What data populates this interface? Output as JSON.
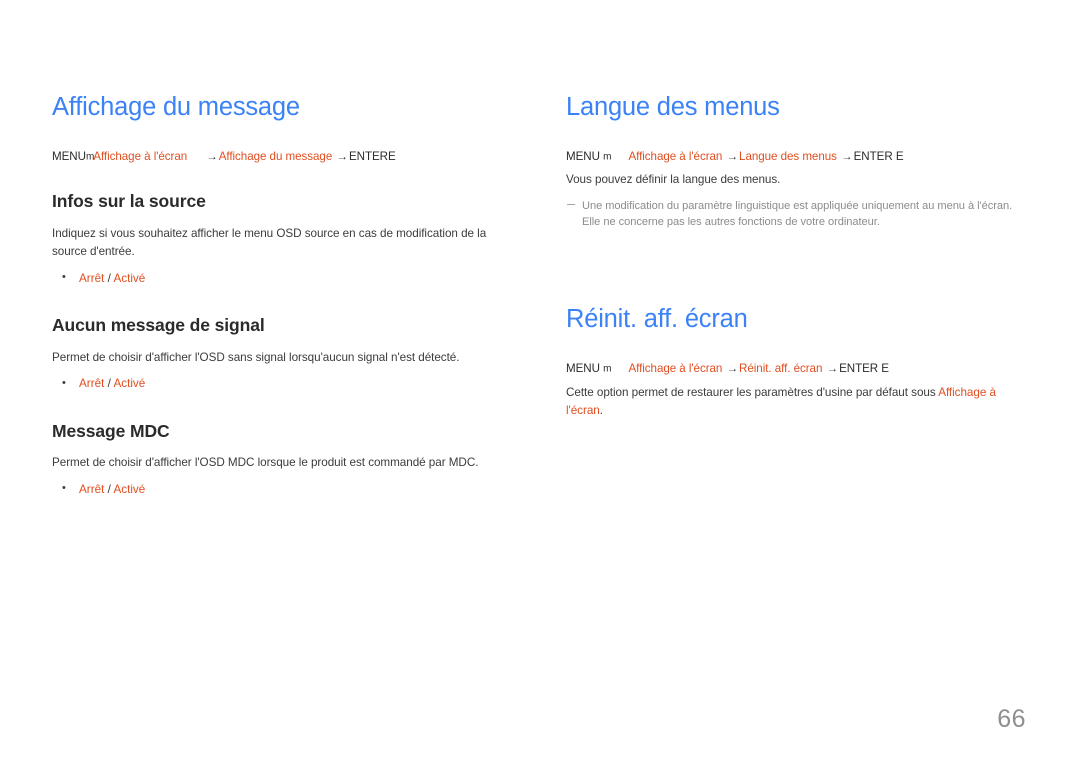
{
  "document": {
    "page_number": "66",
    "accent_heading_color": "#3b82f6",
    "accent_link_color": "#e04e20",
    "body_text_color": "#3c3c3c",
    "note_text_color": "#8c8c8c",
    "background_color": "#ffffff"
  },
  "left_column": {
    "title": "Affichage du message",
    "path": {
      "menu_label": "MENU",
      "menu_glyph": "m",
      "crumb_1": "Affichage à l'écran",
      "arrow_1": "→",
      "crumb_2": "Affichage du message",
      "arrow_2": "→",
      "enter_label": "ENTER",
      "enter_glyph": "E"
    },
    "sections": [
      {
        "heading": "Infos sur la source",
        "body": "Indiquez si vous souhaitez afficher le menu OSD source en cas de modification de la source d'entrée.",
        "options": {
          "first": "Arrêt",
          "separator": "/",
          "second": "Activé"
        }
      },
      {
        "heading": "Aucun message de signal",
        "body": "Permet de choisir d'afficher l'OSD sans signal lorsqu'aucun signal n'est détecté.",
        "options": {
          "first": "Arrêt",
          "separator": "/",
          "second": "Activé"
        }
      },
      {
        "heading": "Message MDC",
        "body": "Permet de choisir d'afficher l'OSD MDC lorsque le produit est commandé par MDC.",
        "options": {
          "first": "Arrêt",
          "separator": "/",
          "second": "Activé"
        }
      }
    ]
  },
  "right_column": {
    "section_language": {
      "title": "Langue des menus",
      "path": {
        "menu_label": "MENU",
        "menu_glyph": "m",
        "crumb_1": "Affichage à l'écran",
        "arrow_1": "→",
        "crumb_2": "Langue des menus",
        "arrow_2": "→",
        "enter_label": "ENTER",
        "enter_glyph": "E"
      },
      "body": "Vous pouvez définir la langue des menus.",
      "notes": [
        "Une modification du paramètre linguistique est appliquée uniquement au menu à l'écran. Elle ne concerne pas les autres fonctions de votre ordinateur."
      ]
    },
    "section_reset": {
      "title": "Réinit. aff. écran",
      "path": {
        "menu_label": "MENU",
        "menu_glyph": "m",
        "crumb_1": "Affichage à l'écran",
        "arrow_1": "→",
        "crumb_2": "Réinit. aff. écran",
        "arrow_2": "→",
        "enter_label": "ENTER",
        "enter_glyph": "E"
      },
      "body_prefix": "Cette option permet de restaurer les paramètres d'usine par défaut sous ",
      "body_link": "Affichage à l'écran",
      "body_suffix": "."
    }
  }
}
